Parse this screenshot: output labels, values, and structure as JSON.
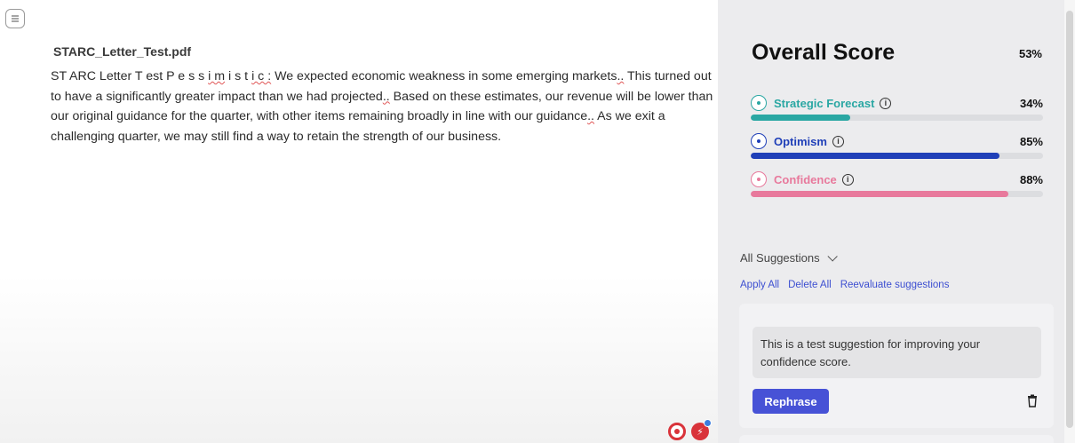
{
  "editor": {
    "doc_title": "STARC_Letter_Test.pdf",
    "body_prefix": "ST ARC Letter T est P e s s ",
    "body_squiggle1": "i m",
    "body_mid1": " i s t ",
    "body_squiggle2": "i c :",
    "body_line1_rest": " We expected economic weakness in some emerging markets",
    "body_mark1": "..",
    "body_after_mark1": " This turned out to have a significantly greater impact than we had projected",
    "body_mark2": "..",
    "body_after_mark2": " Based on these estimates, our revenue will be lower than our original guidance for the quarter, with other items remaining broadly in line with our guidance",
    "body_mark3": "..",
    "body_after_mark3": " As we exit a challenging quarter, we may still find a way to retain the strength of our business."
  },
  "panel": {
    "overall_title": "Overall Score",
    "overall_value": "53%",
    "metrics": [
      {
        "label": "Strategic Forecast",
        "value": "34%",
        "fraction": 0.34,
        "color": "#2aa7a3"
      },
      {
        "label": "Optimism",
        "value": "85%",
        "fraction": 0.85,
        "color": "#1f3fb8"
      },
      {
        "label": "Confidence",
        "value": "88%",
        "fraction": 0.88,
        "color": "#e8799c"
      }
    ],
    "suggestions_label": "All Suggestions",
    "actions": {
      "apply_all": "Apply All",
      "delete_all": "Delete All",
      "reevaluate": "Reevaluate suggestions"
    },
    "suggestion": {
      "text": "This is a test suggestion for improving your confidence score.",
      "button": "Rephrase"
    }
  }
}
